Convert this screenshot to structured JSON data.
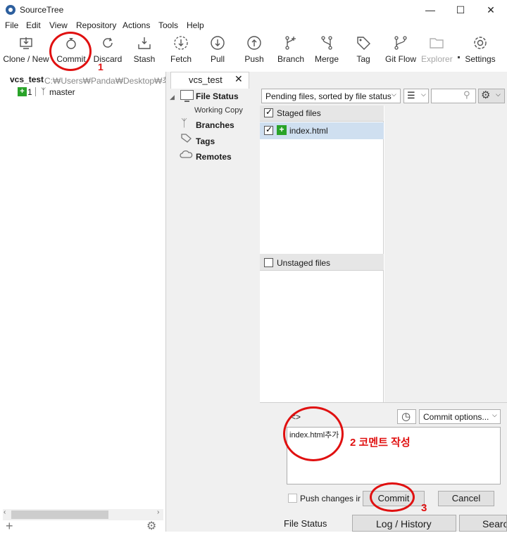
{
  "window": {
    "title": "SourceTree"
  },
  "menu": [
    "File",
    "Edit",
    "View",
    "Repository",
    "Actions",
    "Tools",
    "Help"
  ],
  "toolbar": {
    "clone": "Clone / New",
    "commit": "Commit",
    "discard": "Discard",
    "stash": "Stash",
    "fetch": "Fetch",
    "pull": "Pull",
    "push": "Push",
    "branch": "Branch",
    "merge": "Merge",
    "tag": "Tag",
    "gitflow": "Git Flow",
    "explorer": "Explorer",
    "settings": "Settings"
  },
  "repo": {
    "name": "vcs_test",
    "path": "C:₩Users₩Panda₩Desktop₩최미",
    "badge": "1",
    "branch": "master"
  },
  "tab": {
    "label": "vcs_test"
  },
  "sidebar": {
    "file_status": "File Status",
    "working_copy": "Working Copy",
    "branches": "Branches",
    "tags": "Tags",
    "remotes": "Remotes"
  },
  "filter": {
    "sort_label": "Pending files, sorted by file status"
  },
  "staged": {
    "header": "Staged files",
    "files": [
      "index.html"
    ]
  },
  "unstaged": {
    "header": "Unstaged files"
  },
  "commit": {
    "message": "index.html추가",
    "options_label": "Commit options...",
    "push_label": "Push changes ir",
    "commit_button": "Commit",
    "cancel_button": "Cancel"
  },
  "bottom_tabs": {
    "file_status": "File Status",
    "log_history": "Log / History",
    "search": "Search"
  },
  "annotations": {
    "step1": "1",
    "step2": "2 코멘트 작성",
    "step3": "3"
  },
  "colors": {
    "staged_bg": "#cfdff0",
    "annotation_red": "#e01010",
    "add_green": "#29a329"
  }
}
